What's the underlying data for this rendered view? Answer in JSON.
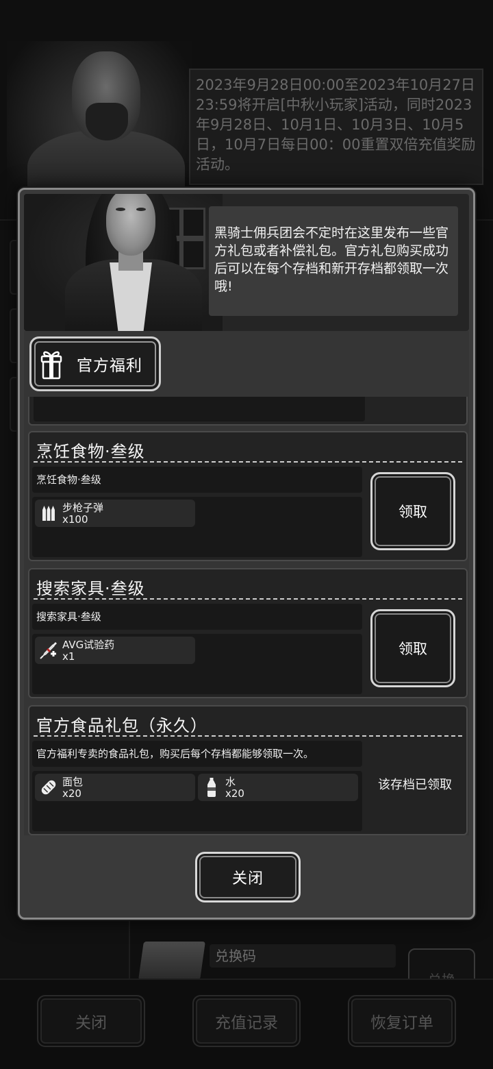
{
  "background": {
    "announcement": "2023年9月28日00:00至2023年10月27日23:59将开启[中秋小玩家]活动，同时2023年9月28日、10月1日、10月3日、10月5日，10月7日每日00：00重置双倍充值奖励活动。",
    "redeem_label": "兑换码",
    "redeem_button": "兑换",
    "bottom_buttons": {
      "close": "关闭",
      "recharge_history": "充值记录",
      "restore_order": "恢复订单"
    }
  },
  "modal": {
    "intro_text": "黑骑士佣兵团会不定时在这里发布一些官方礼包或者补偿礼包。官方礼包购买成功后可以在每个存档和新开存档都领取一次哦!",
    "tab_label": "官方福利",
    "cards": [
      {
        "title": "烹饪食物·叁级",
        "subtitle": "烹饪食物·叁级",
        "items": [
          {
            "icon": "bullets-icon",
            "name": "步枪子弹",
            "qty": "x100"
          }
        ],
        "action": "领取"
      },
      {
        "title": "搜索家具·叁级",
        "subtitle": "搜索家具·叁级",
        "items": [
          {
            "icon": "syringe-icon",
            "name": "AVG试验药",
            "qty": "x1"
          }
        ],
        "action": "领取"
      },
      {
        "title": "官方食品礼包（永久）",
        "subtitle": "官方福利专卖的食品礼包，购买后每个存档都能够领取一次。",
        "items": [
          {
            "icon": "bread-icon",
            "name": "面包",
            "qty": "x20"
          },
          {
            "icon": "water-bottle-icon",
            "name": "水",
            "qty": "x20"
          }
        ],
        "status": "该存档已领取"
      }
    ],
    "close_button": "关闭"
  }
}
